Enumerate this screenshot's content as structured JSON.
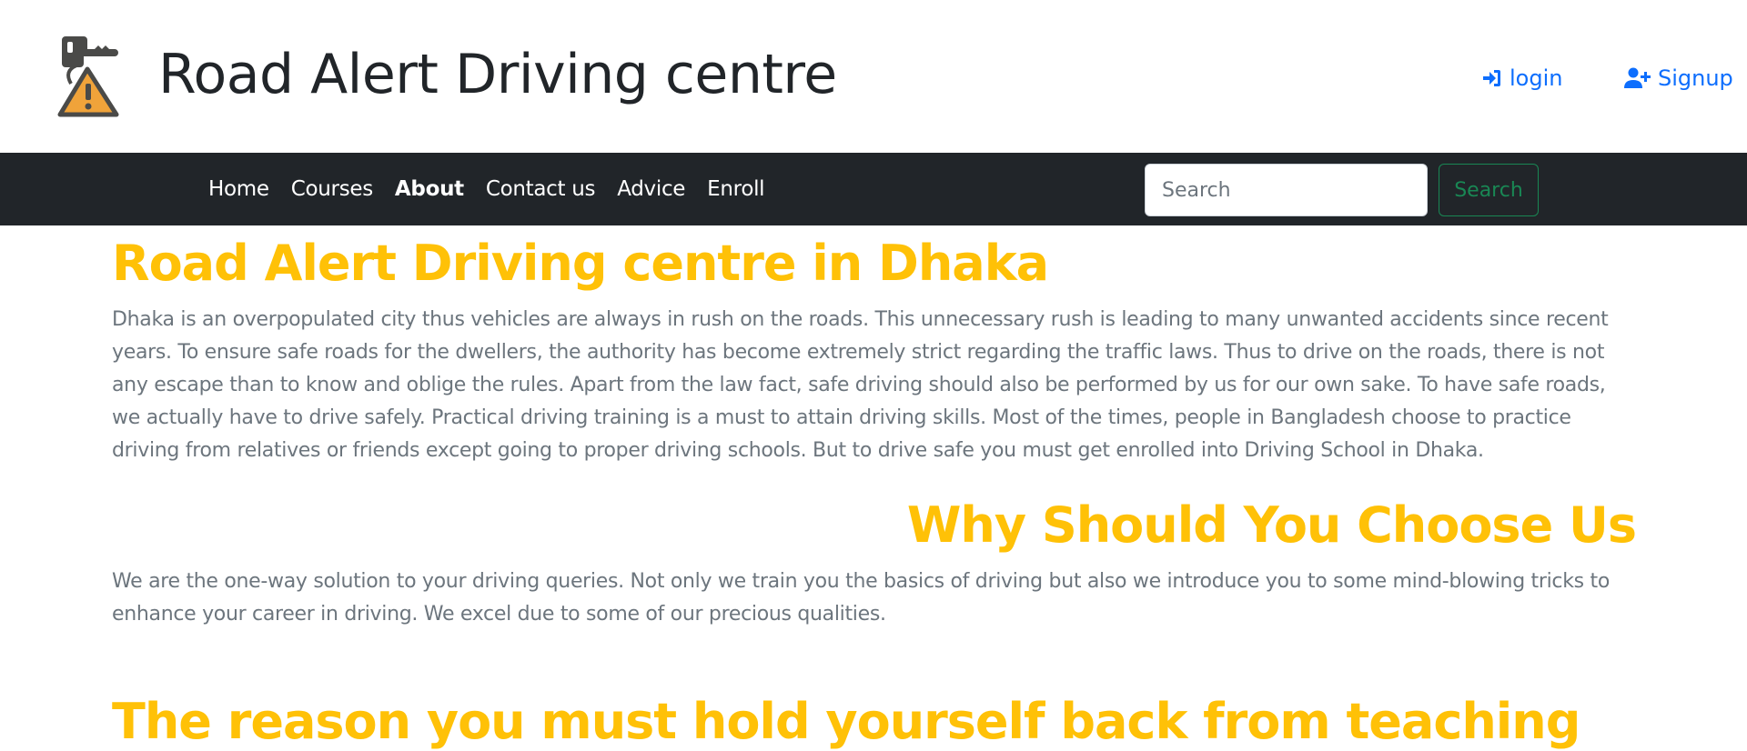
{
  "header": {
    "logo_icon": "warning-key-icon",
    "title": "Road Alert Driving centre",
    "login_label": "login",
    "signup_label": "Signup",
    "login_icon": "sign-in-icon",
    "signup_icon": "user-plus-icon"
  },
  "nav": {
    "items": [
      {
        "label": "Home",
        "active": false
      },
      {
        "label": "Courses",
        "active": false
      },
      {
        "label": "About",
        "active": true
      },
      {
        "label": "Contact us",
        "active": false
      },
      {
        "label": "Advice",
        "active": false
      },
      {
        "label": "Enroll",
        "active": false
      }
    ],
    "search": {
      "placeholder": "Search",
      "value": "",
      "button_label": "Search"
    }
  },
  "main": {
    "heading": "Road Alert Driving centre in Dhaka",
    "intro": "Dhaka is an overpopulated city thus vehicles are always in rush on the roads. This unnecessary rush is leading to many unwanted accidents since recent years. To ensure safe roads for the dwellers, the authority has become extremely strict regarding the traffic laws. Thus to drive on the roads, there is not any escape than to know and oblige the rules. Apart from the law fact, safe driving should also be performed by us for our own sake. To have safe roads, we actually have to drive safely. Practical driving training is a must to attain driving skills. Most of the times, people in Bangladesh choose to practice driving from relatives or friends except going to proper driving schools. But to drive safe you must get enrolled into Driving School in Dhaka.",
    "why_heading": "Why Should You Choose Us",
    "why_text": "We are the one-way solution to your driving queries. Not only we train you the basics of driving but also we introduce you to some mind-blowing tricks to enhance your career in driving. We excel due to some of our precious qualities.",
    "third_heading": "The reason you must hold yourself back from teaching"
  },
  "colors": {
    "heading": "#ffc107",
    "body_text": "#6c757d",
    "nav_bg": "#212529",
    "link": "#0d6efd",
    "search_button": "#198754"
  }
}
